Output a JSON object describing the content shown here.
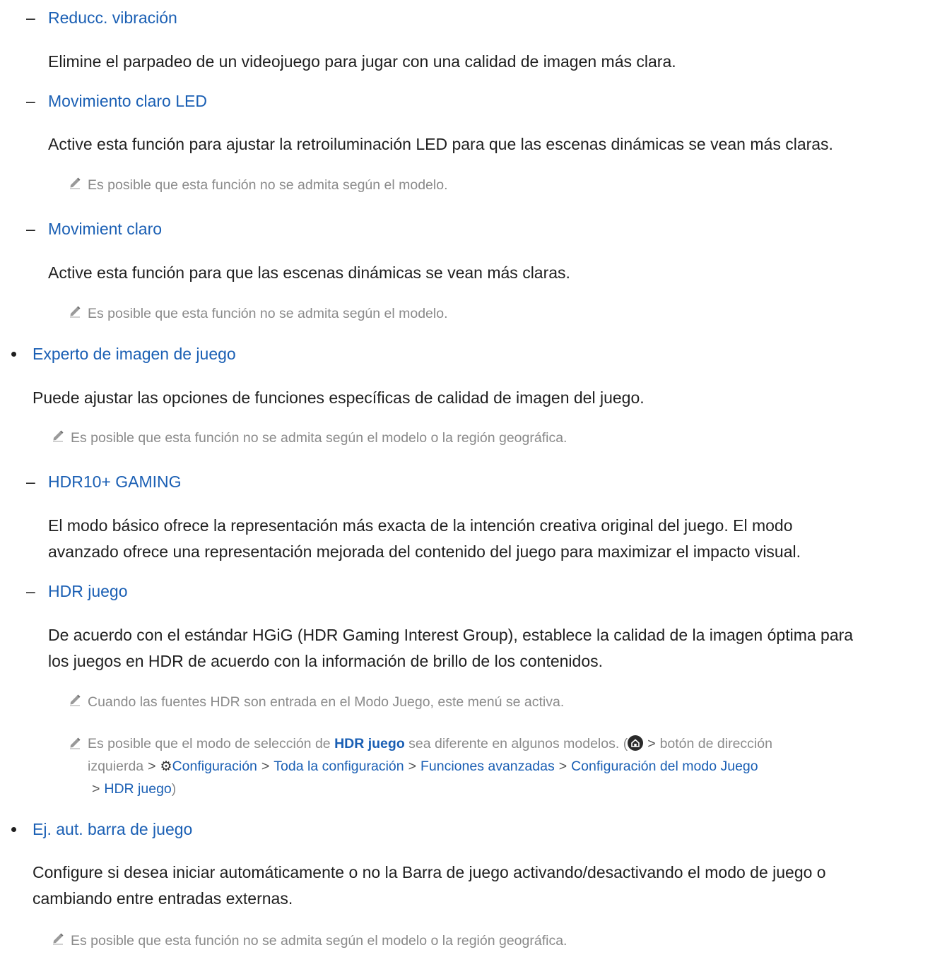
{
  "items": {
    "reducc": {
      "title": "Reducc. vibración",
      "desc": "Elimine el parpadeo de un videojuego para jugar con una calidad de imagen más clara."
    },
    "mov_led": {
      "title": "Movimiento claro LED",
      "desc": "Active esta función para ajustar la retroiluminación LED para que las escenas dinámicas se vean más claras.",
      "note": "Es posible que esta función no se admita según el modelo."
    },
    "mov_claro": {
      "title": "Movimient claro",
      "desc": "Active esta función para que las escenas dinámicas se vean más claras.",
      "note": "Es posible que esta función no se admita según el modelo."
    },
    "experto": {
      "title": "Experto de imagen de juego",
      "desc": "Puede ajustar las opciones de funciones específicas de calidad de imagen del juego.",
      "note": "Es posible que esta función no se admita según el modelo o la región geográfica."
    },
    "hdr10": {
      "title": "HDR10+ GAMING",
      "desc_l1": "El modo básico ofrece la representación más exacta de la intención creativa original del juego. El modo",
      "desc_l2": "avanzado ofrece una representación mejorada del contenido del juego para maximizar el impacto visual."
    },
    "hdr_juego": {
      "title": "HDR juego",
      "desc_l1": "De acuerdo con el estándar HGiG (HDR Gaming Interest Group), establece la calidad de la imagen óptima para",
      "desc_l2": "los juegos en HDR de acuerdo con la información de brillo de los contenidos.",
      "note1": "Cuando las fuentes HDR son entrada en el Modo Juego, este menú se activa.",
      "note2_pre": "Es posible que el modo de selección de ",
      "note2_bold": "HDR juego",
      "note2_post": " sea diferente en algunos modelos. (",
      "note2_dir": "botón de dirección",
      "note2_izq": "izquierda",
      "path": [
        "Configuración",
        "Toda la configuración",
        "Funciones avanzadas",
        "Configuración del modo Juego",
        "HDR juego"
      ],
      "close_paren": ")"
    },
    "ej_aut": {
      "title": "Ej. aut. barra de juego",
      "desc_l1": "Configure si desea iniciar automáticamente o no la Barra de juego activando/desactivando el modo de juego o",
      "desc_l2": "cambiando entre entradas externas.",
      "note": "Es posible que esta función no se admita según el modelo o la región geográfica."
    }
  },
  "glyphs": {
    "dash": "–",
    "chevron": ">",
    "gear": "⚙"
  },
  "icons": [
    "pencil-note-icon",
    "home-icon",
    "gear-icon",
    "chevron-right-icon"
  ],
  "colors": {
    "link": "#1a5fb4",
    "text": "#1f1f1f",
    "note": "#8a8a8a"
  }
}
